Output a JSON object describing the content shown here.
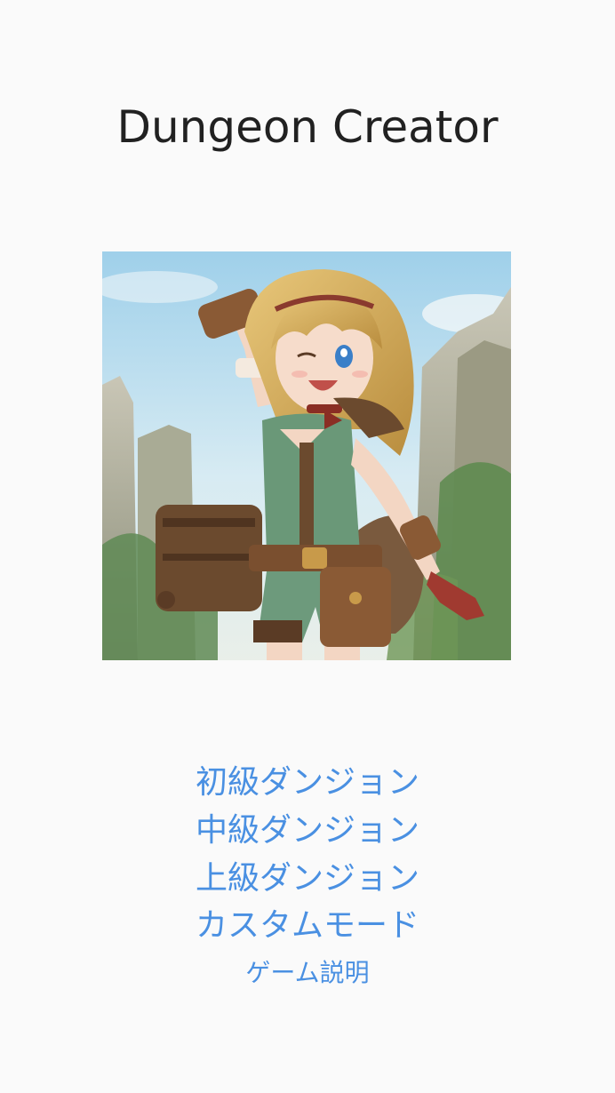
{
  "app": {
    "title": "Dungeon Creator"
  },
  "hero": {
    "icon": "adventurer-girl-illustration"
  },
  "menu": {
    "beginner": "初級ダンジョン",
    "intermediate": "中級ダンジョン",
    "advanced": "上級ダンジョン",
    "custom": "カスタムモード",
    "howto": "ゲーム説明"
  },
  "colors": {
    "background": "#fafafa",
    "title": "#212121",
    "link": "#4a90e2"
  }
}
